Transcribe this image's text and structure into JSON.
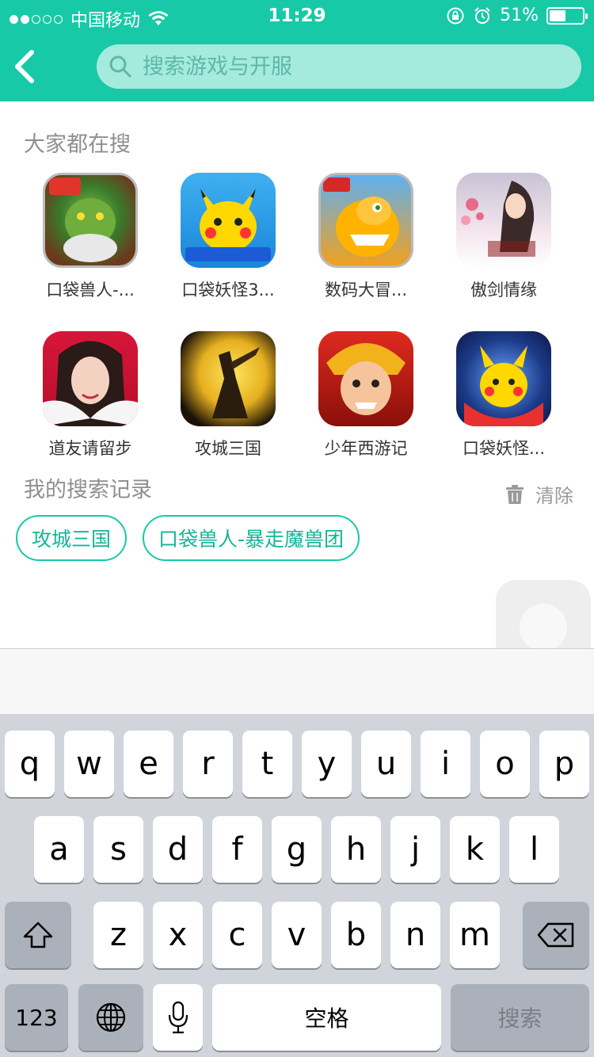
{
  "status_bar": {
    "carrier": "中国移动",
    "time": "11:29",
    "battery_percent": "51%",
    "battery_level": 0.51
  },
  "nav": {
    "back_icon": "chevron-left-icon",
    "search_placeholder": "搜索游戏与开服"
  },
  "hot_search": {
    "title": "大家都在搜",
    "games": [
      {
        "name": "口袋兽人-..."
      },
      {
        "name": "口袋妖怪3..."
      },
      {
        "name": "数码大冒..."
      },
      {
        "name": "傲剑情缘"
      },
      {
        "name": "道友请留步"
      },
      {
        "name": "攻城三国"
      },
      {
        "name": "少年西游记"
      },
      {
        "name": "口袋妖怪..."
      }
    ]
  },
  "history": {
    "title": "我的搜索记录",
    "clear_label": "清除",
    "items": [
      "攻城三国",
      "口袋兽人-暴走魔兽团"
    ]
  },
  "keyboard": {
    "row1": [
      "q",
      "w",
      "e",
      "r",
      "t",
      "y",
      "u",
      "i",
      "o",
      "p"
    ],
    "row2": [
      "a",
      "s",
      "d",
      "f",
      "g",
      "h",
      "j",
      "k",
      "l"
    ],
    "row3": [
      "z",
      "x",
      "c",
      "v",
      "b",
      "n",
      "m"
    ],
    "numbers_label": "123",
    "space_label": "空格",
    "search_label": "搜索"
  },
  "colors": {
    "accent": "#18c9a8",
    "search_bg": "#a4ebdd",
    "keyboard_bg": "#d1d5db"
  }
}
